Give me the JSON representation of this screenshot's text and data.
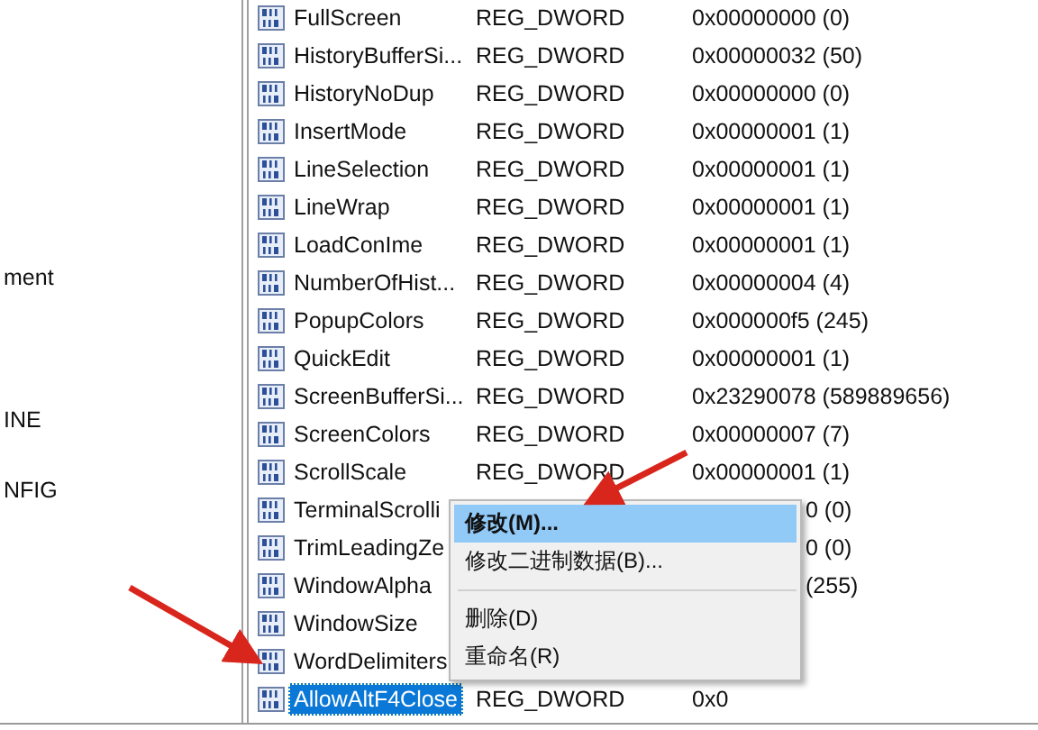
{
  "tree_pane": {
    "items": [
      "ment",
      "INE",
      "NFIG"
    ]
  },
  "values": [
    {
      "name": "FullScreen",
      "type": "REG_DWORD",
      "value": "0x00000000 (0)",
      "selected": false
    },
    {
      "name": "HistoryBufferSi...",
      "type": "REG_DWORD",
      "value": "0x00000032 (50)",
      "selected": false
    },
    {
      "name": "HistoryNoDup",
      "type": "REG_DWORD",
      "value": "0x00000000 (0)",
      "selected": false
    },
    {
      "name": "InsertMode",
      "type": "REG_DWORD",
      "value": "0x00000001 (1)",
      "selected": false
    },
    {
      "name": "LineSelection",
      "type": "REG_DWORD",
      "value": "0x00000001 (1)",
      "selected": false
    },
    {
      "name": "LineWrap",
      "type": "REG_DWORD",
      "value": "0x00000001 (1)",
      "selected": false
    },
    {
      "name": "LoadConIme",
      "type": "REG_DWORD",
      "value": "0x00000001 (1)",
      "selected": false
    },
    {
      "name": "NumberOfHist...",
      "type": "REG_DWORD",
      "value": "0x00000004 (4)",
      "selected": false
    },
    {
      "name": "PopupColors",
      "type": "REG_DWORD",
      "value": "0x000000f5 (245)",
      "selected": false
    },
    {
      "name": "QuickEdit",
      "type": "REG_DWORD",
      "value": "0x00000001 (1)",
      "selected": false
    },
    {
      "name": "ScreenBufferSi...",
      "type": "REG_DWORD",
      "value": "0x23290078 (589889656)",
      "selected": false
    },
    {
      "name": "ScreenColors",
      "type": "REG_DWORD",
      "value": "0x00000007 (7)",
      "selected": false
    },
    {
      "name": "ScrollScale",
      "type": "REG_DWORD",
      "value": "0x00000001 (1)",
      "selected": false
    },
    {
      "name": "TerminalScrolli",
      "value_fragment": "0 (0)",
      "selected": false
    },
    {
      "name": "TrimLeadingZe",
      "value_fragment": "0 (0)",
      "selected": false
    },
    {
      "name": "WindowAlpha",
      "value_fragment": "(255)",
      "selected": false
    },
    {
      "name": "WindowSize",
      "selected": false
    },
    {
      "name": "WordDelimiters",
      "selected": false
    },
    {
      "name": "AllowAltF4Close",
      "type": "REG_DWORD",
      "value": "0x0",
      "selected": true
    }
  ],
  "context_menu": {
    "items": [
      {
        "kind": "item",
        "label": "修改(M)...",
        "selected": true
      },
      {
        "kind": "item",
        "label": "修改二进制数据(B)...",
        "selected": false
      },
      {
        "kind": "separator"
      },
      {
        "kind": "item",
        "label": "删除(D)",
        "selected": false
      },
      {
        "kind": "item",
        "label": "重命名(R)",
        "selected": false
      }
    ]
  }
}
